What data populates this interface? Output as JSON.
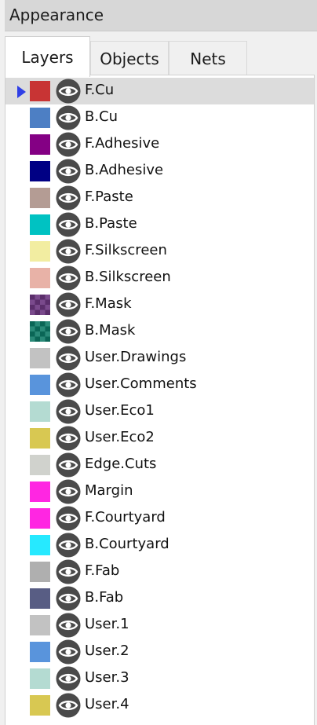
{
  "panel_title": "Appearance",
  "tabs": [
    {
      "label": "Layers",
      "active": true
    },
    {
      "label": "Objects",
      "active": false
    },
    {
      "label": "Nets",
      "active": false
    }
  ],
  "selected_index": 0,
  "layers": [
    {
      "name": "F.Cu",
      "color": "#c83434",
      "pattern": "solid"
    },
    {
      "name": "B.Cu",
      "color": "#4d7fc4",
      "pattern": "solid"
    },
    {
      "name": "F.Adhesive",
      "color": "#840084",
      "pattern": "solid"
    },
    {
      "name": "B.Adhesive",
      "color": "#000084",
      "pattern": "solid"
    },
    {
      "name": "F.Paste",
      "color": "#b49c94",
      "pattern": "solid"
    },
    {
      "name": "B.Paste",
      "color": "#00c2c2",
      "pattern": "solid"
    },
    {
      "name": "F.Silkscreen",
      "color": "#f2eda1",
      "pattern": "solid"
    },
    {
      "name": "B.Silkscreen",
      "color": "#e8b2a7",
      "pattern": "solid"
    },
    {
      "name": "F.Mask",
      "color": "#5b2e6b",
      "color2": "#7a4a8c",
      "pattern": "checker"
    },
    {
      "name": "B.Mask",
      "color": "#0a6656",
      "color2": "#2a8a78",
      "pattern": "checker"
    },
    {
      "name": "User.Drawings",
      "color": "#c2c2c2",
      "pattern": "solid"
    },
    {
      "name": "User.Comments",
      "color": "#5994dc",
      "pattern": "solid"
    },
    {
      "name": "User.Eco1",
      "color": "#b4dbd2",
      "pattern": "solid"
    },
    {
      "name": "User.Eco2",
      "color": "#d8c852",
      "pattern": "solid"
    },
    {
      "name": "Edge.Cuts",
      "color": "#d0d2cd",
      "pattern": "solid"
    },
    {
      "name": "Margin",
      "color": "#ff26e2",
      "pattern": "solid"
    },
    {
      "name": "F.Courtyard",
      "color": "#ff26e2",
      "pattern": "solid"
    },
    {
      "name": "B.Courtyard",
      "color": "#26e9ff",
      "pattern": "solid"
    },
    {
      "name": "F.Fab",
      "color": "#afafaf",
      "pattern": "solid"
    },
    {
      "name": "B.Fab",
      "color": "#585d84",
      "pattern": "solid"
    },
    {
      "name": "User.1",
      "color": "#c2c2c2",
      "pattern": "solid"
    },
    {
      "name": "User.2",
      "color": "#5994dc",
      "pattern": "solid"
    },
    {
      "name": "User.3",
      "color": "#b4dbd2",
      "pattern": "solid"
    },
    {
      "name": "User.4",
      "color": "#d8c852",
      "pattern": "solid"
    }
  ],
  "icons": {
    "visibility": "eye-icon",
    "selection": "triangle-right-icon"
  },
  "colors": {
    "selection_arrow": "#2f3fe6",
    "selected_row": "#dcdcdc",
    "eye_fill": "#4a4a4a"
  }
}
